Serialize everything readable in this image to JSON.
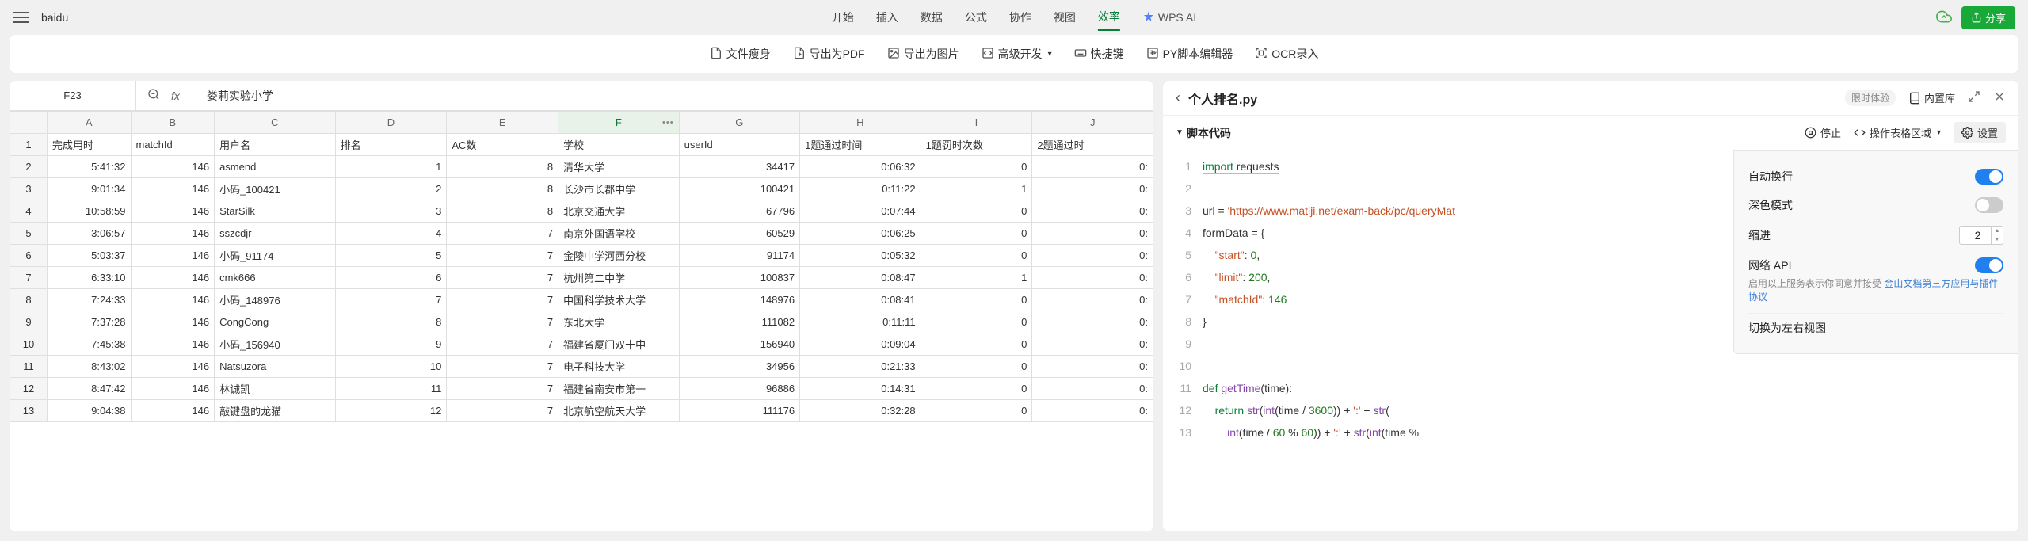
{
  "header": {
    "doc_title": "baidu",
    "tabs": [
      "开始",
      "插入",
      "数据",
      "公式",
      "协作",
      "视图",
      "效率"
    ],
    "active_tab_index": 6,
    "wps_ai": "WPS AI",
    "share_label": "分享"
  },
  "toolbar": {
    "items": [
      {
        "icon": "file-slim",
        "label": "文件瘦身"
      },
      {
        "icon": "pdf",
        "label": "导出为PDF"
      },
      {
        "icon": "image",
        "label": "导出为图片"
      },
      {
        "icon": "dev",
        "label": "高级开发",
        "dropdown": true
      },
      {
        "icon": "shortcut",
        "label": "快捷键"
      },
      {
        "icon": "py",
        "label": "PY脚本编辑器"
      },
      {
        "icon": "ocr",
        "label": "OCR录入"
      }
    ]
  },
  "formula_bar": {
    "cell_ref": "F23",
    "fx": "fx",
    "content": "娄莉实验小学"
  },
  "sheet": {
    "columns": [
      "A",
      "B",
      "C",
      "D",
      "E",
      "F",
      "G",
      "H",
      "I",
      "J"
    ],
    "active_col": "F",
    "header_row": [
      "完成用时",
      "matchId",
      "用户名",
      "排名",
      "AC数",
      "学校",
      "userId",
      "1题通过时间",
      "1题罚时次数",
      "2题通过时"
    ],
    "rows": [
      {
        "n": 2,
        "cells": [
          "5:41:32",
          "146",
          "asmend",
          "1",
          "8",
          "清华大学",
          "34417",
          "0:06:32",
          "0",
          "0:"
        ]
      },
      {
        "n": 3,
        "cells": [
          "9:01:34",
          "146",
          "小码_100421",
          "2",
          "8",
          "长沙市长郡中学",
          "100421",
          "0:11:22",
          "1",
          "0:"
        ]
      },
      {
        "n": 4,
        "cells": [
          "10:58:59",
          "146",
          "StarSilk",
          "3",
          "8",
          "北京交通大学",
          "67796",
          "0:07:44",
          "0",
          "0:"
        ]
      },
      {
        "n": 5,
        "cells": [
          "3:06:57",
          "146",
          "sszcdjr",
          "4",
          "7",
          "南京外国语学校",
          "60529",
          "0:06:25",
          "0",
          "0:"
        ]
      },
      {
        "n": 6,
        "cells": [
          "5:03:37",
          "146",
          "小码_91174",
          "5",
          "7",
          "金陵中学河西分校",
          "91174",
          "0:05:32",
          "0",
          "0:"
        ]
      },
      {
        "n": 7,
        "cells": [
          "6:33:10",
          "146",
          "cmk666",
          "6",
          "7",
          "杭州第二中学",
          "100837",
          "0:08:47",
          "1",
          "0:"
        ]
      },
      {
        "n": 8,
        "cells": [
          "7:24:33",
          "146",
          "小码_148976",
          "7",
          "7",
          "中国科学技术大学",
          "148976",
          "0:08:41",
          "0",
          "0:"
        ]
      },
      {
        "n": 9,
        "cells": [
          "7:37:28",
          "146",
          "CongCong",
          "8",
          "7",
          "东北大学",
          "111082",
          "0:11:11",
          "0",
          "0:"
        ]
      },
      {
        "n": 10,
        "cells": [
          "7:45:38",
          "146",
          "小码_156940",
          "9",
          "7",
          "福建省厦门双十中",
          "156940",
          "0:09:04",
          "0",
          "0:"
        ]
      },
      {
        "n": 11,
        "cells": [
          "8:43:02",
          "146",
          "Natsuzora",
          "10",
          "7",
          "电子科技大学",
          "34956",
          "0:21:33",
          "0",
          "0:"
        ]
      },
      {
        "n": 12,
        "cells": [
          "8:47:42",
          "146",
          "林诚凯",
          "11",
          "7",
          "福建省南安市第一",
          "96886",
          "0:14:31",
          "0",
          "0:"
        ]
      },
      {
        "n": 13,
        "cells": [
          "9:04:38",
          "146",
          "敲键盘的龙猫",
          "12",
          "7",
          "北京航空航天大学",
          "111176",
          "0:32:28",
          "0",
          "0:"
        ]
      }
    ]
  },
  "script_panel": {
    "title": "个人排名.py",
    "limited": "限时体验",
    "builtin_lib": "内置库",
    "section_label": "脚本代码",
    "stop_label": "停止",
    "operate_label": "操作表格区域",
    "settings_label": "设置"
  },
  "code": {
    "lines": [
      "import requests",
      "",
      "url = 'https://www.matiji.net/exam-back/pc/queryMat",
      "formData = {",
      "    \"start\": 0,",
      "    \"limit\": 200,",
      "    \"matchId\": 146",
      "}",
      "",
      "",
      "def getTime(time):",
      "    return str(int(time / 3600)) + ':' + str(",
      "        int(time / 60 % 60)) + ':' + str(int(time %"
    ]
  },
  "settings": {
    "auto_wrap": "自动换行",
    "dark_mode": "深色模式",
    "indent": "缩进",
    "indent_value": "2",
    "network_api": "网络 API",
    "note_prefix": "启用以上服务表示你同意并接受 ",
    "note_link": "金山文档第三方应用与插件协议",
    "layout_switch": "切换为左右视图"
  }
}
